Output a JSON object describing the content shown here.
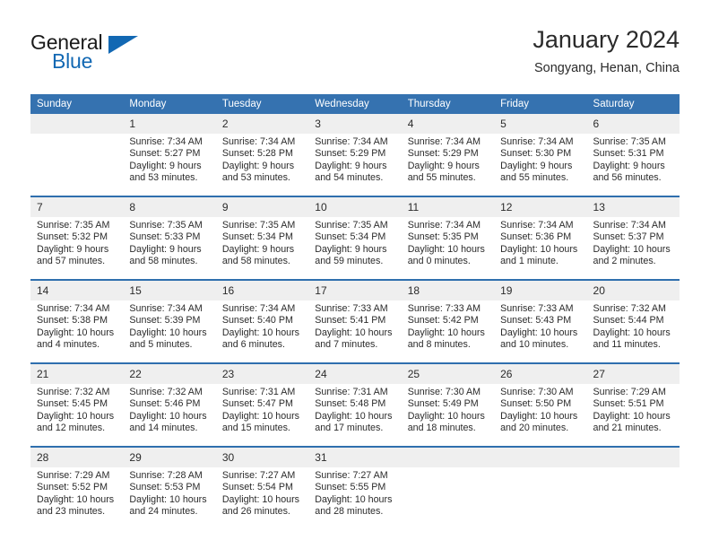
{
  "brand": {
    "name_part1": "General",
    "name_part2": "Blue",
    "accent_color": "#1268b3"
  },
  "header": {
    "title": "January 2024",
    "subtitle": "Songyang, Henan, China"
  },
  "calendar": {
    "header_bg": "#3572b0",
    "daynum_bg": "#efefef",
    "weekdays": [
      "Sunday",
      "Monday",
      "Tuesday",
      "Wednesday",
      "Thursday",
      "Friday",
      "Saturday"
    ],
    "weeks": [
      [
        {
          "day": "",
          "blank": true,
          "sunrise": "",
          "sunset": "",
          "daylight": ""
        },
        {
          "day": "1",
          "sunrise": "Sunrise: 7:34 AM",
          "sunset": "Sunset: 5:27 PM",
          "daylight": "Daylight: 9 hours and 53 minutes."
        },
        {
          "day": "2",
          "sunrise": "Sunrise: 7:34 AM",
          "sunset": "Sunset: 5:28 PM",
          "daylight": "Daylight: 9 hours and 53 minutes."
        },
        {
          "day": "3",
          "sunrise": "Sunrise: 7:34 AM",
          "sunset": "Sunset: 5:29 PM",
          "daylight": "Daylight: 9 hours and 54 minutes."
        },
        {
          "day": "4",
          "sunrise": "Sunrise: 7:34 AM",
          "sunset": "Sunset: 5:29 PM",
          "daylight": "Daylight: 9 hours and 55 minutes."
        },
        {
          "day": "5",
          "sunrise": "Sunrise: 7:34 AM",
          "sunset": "Sunset: 5:30 PM",
          "daylight": "Daylight: 9 hours and 55 minutes."
        },
        {
          "day": "6",
          "sunrise": "Sunrise: 7:35 AM",
          "sunset": "Sunset: 5:31 PM",
          "daylight": "Daylight: 9 hours and 56 minutes."
        }
      ],
      [
        {
          "day": "7",
          "sunrise": "Sunrise: 7:35 AM",
          "sunset": "Sunset: 5:32 PM",
          "daylight": "Daylight: 9 hours and 57 minutes."
        },
        {
          "day": "8",
          "sunrise": "Sunrise: 7:35 AM",
          "sunset": "Sunset: 5:33 PM",
          "daylight": "Daylight: 9 hours and 58 minutes."
        },
        {
          "day": "9",
          "sunrise": "Sunrise: 7:35 AM",
          "sunset": "Sunset: 5:34 PM",
          "daylight": "Daylight: 9 hours and 58 minutes."
        },
        {
          "day": "10",
          "sunrise": "Sunrise: 7:35 AM",
          "sunset": "Sunset: 5:34 PM",
          "daylight": "Daylight: 9 hours and 59 minutes."
        },
        {
          "day": "11",
          "sunrise": "Sunrise: 7:34 AM",
          "sunset": "Sunset: 5:35 PM",
          "daylight": "Daylight: 10 hours and 0 minutes."
        },
        {
          "day": "12",
          "sunrise": "Sunrise: 7:34 AM",
          "sunset": "Sunset: 5:36 PM",
          "daylight": "Daylight: 10 hours and 1 minute."
        },
        {
          "day": "13",
          "sunrise": "Sunrise: 7:34 AM",
          "sunset": "Sunset: 5:37 PM",
          "daylight": "Daylight: 10 hours and 2 minutes."
        }
      ],
      [
        {
          "day": "14",
          "sunrise": "Sunrise: 7:34 AM",
          "sunset": "Sunset: 5:38 PM",
          "daylight": "Daylight: 10 hours and 4 minutes."
        },
        {
          "day": "15",
          "sunrise": "Sunrise: 7:34 AM",
          "sunset": "Sunset: 5:39 PM",
          "daylight": "Daylight: 10 hours and 5 minutes."
        },
        {
          "day": "16",
          "sunrise": "Sunrise: 7:34 AM",
          "sunset": "Sunset: 5:40 PM",
          "daylight": "Daylight: 10 hours and 6 minutes."
        },
        {
          "day": "17",
          "sunrise": "Sunrise: 7:33 AM",
          "sunset": "Sunset: 5:41 PM",
          "daylight": "Daylight: 10 hours and 7 minutes."
        },
        {
          "day": "18",
          "sunrise": "Sunrise: 7:33 AM",
          "sunset": "Sunset: 5:42 PM",
          "daylight": "Daylight: 10 hours and 8 minutes."
        },
        {
          "day": "19",
          "sunrise": "Sunrise: 7:33 AM",
          "sunset": "Sunset: 5:43 PM",
          "daylight": "Daylight: 10 hours and 10 minutes."
        },
        {
          "day": "20",
          "sunrise": "Sunrise: 7:32 AM",
          "sunset": "Sunset: 5:44 PM",
          "daylight": "Daylight: 10 hours and 11 minutes."
        }
      ],
      [
        {
          "day": "21",
          "sunrise": "Sunrise: 7:32 AM",
          "sunset": "Sunset: 5:45 PM",
          "daylight": "Daylight: 10 hours and 12 minutes."
        },
        {
          "day": "22",
          "sunrise": "Sunrise: 7:32 AM",
          "sunset": "Sunset: 5:46 PM",
          "daylight": "Daylight: 10 hours and 14 minutes."
        },
        {
          "day": "23",
          "sunrise": "Sunrise: 7:31 AM",
          "sunset": "Sunset: 5:47 PM",
          "daylight": "Daylight: 10 hours and 15 minutes."
        },
        {
          "day": "24",
          "sunrise": "Sunrise: 7:31 AM",
          "sunset": "Sunset: 5:48 PM",
          "daylight": "Daylight: 10 hours and 17 minutes."
        },
        {
          "day": "25",
          "sunrise": "Sunrise: 7:30 AM",
          "sunset": "Sunset: 5:49 PM",
          "daylight": "Daylight: 10 hours and 18 minutes."
        },
        {
          "day": "26",
          "sunrise": "Sunrise: 7:30 AM",
          "sunset": "Sunset: 5:50 PM",
          "daylight": "Daylight: 10 hours and 20 minutes."
        },
        {
          "day": "27",
          "sunrise": "Sunrise: 7:29 AM",
          "sunset": "Sunset: 5:51 PM",
          "daylight": "Daylight: 10 hours and 21 minutes."
        }
      ],
      [
        {
          "day": "28",
          "sunrise": "Sunrise: 7:29 AM",
          "sunset": "Sunset: 5:52 PM",
          "daylight": "Daylight: 10 hours and 23 minutes."
        },
        {
          "day": "29",
          "sunrise": "Sunrise: 7:28 AM",
          "sunset": "Sunset: 5:53 PM",
          "daylight": "Daylight: 10 hours and 24 minutes."
        },
        {
          "day": "30",
          "sunrise": "Sunrise: 7:27 AM",
          "sunset": "Sunset: 5:54 PM",
          "daylight": "Daylight: 10 hours and 26 minutes."
        },
        {
          "day": "31",
          "sunrise": "Sunrise: 7:27 AM",
          "sunset": "Sunset: 5:55 PM",
          "daylight": "Daylight: 10 hours and 28 minutes."
        },
        {
          "day": "",
          "blank": true,
          "sunrise": "",
          "sunset": "",
          "daylight": ""
        },
        {
          "day": "",
          "blank": true,
          "sunrise": "",
          "sunset": "",
          "daylight": ""
        },
        {
          "day": "",
          "blank": true,
          "sunrise": "",
          "sunset": "",
          "daylight": ""
        }
      ]
    ]
  }
}
